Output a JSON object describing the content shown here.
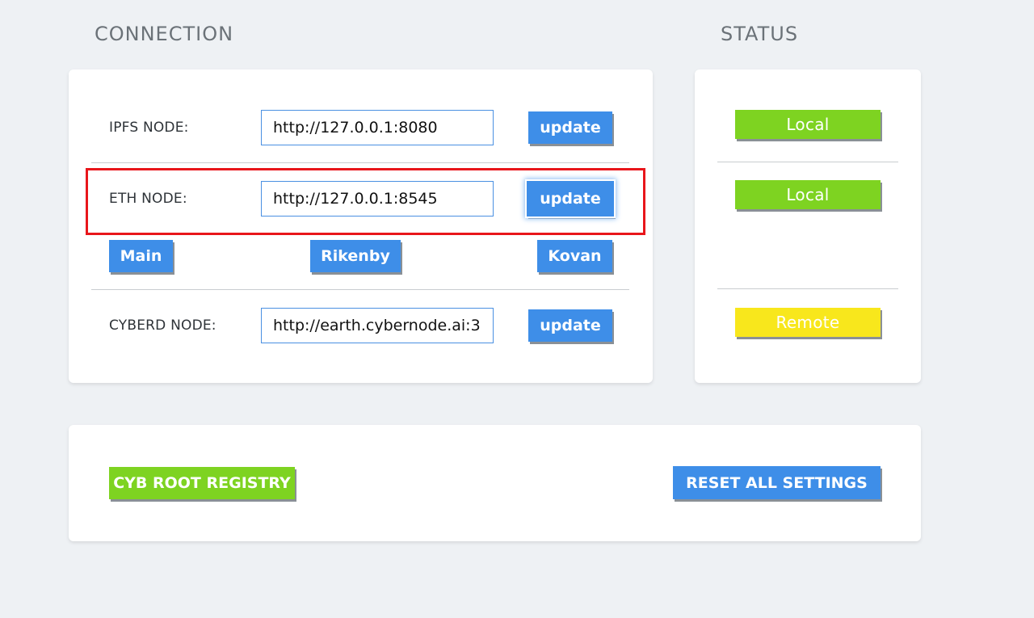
{
  "headings": {
    "connection": "CONNECTION",
    "status": "STATUS"
  },
  "connection": {
    "ipfs": {
      "label": "IPFS NODE:",
      "value": "http://127.0.0.1:8080",
      "button": "update"
    },
    "eth": {
      "label": "ETH NODE:",
      "value": "http://127.0.0.1:8545",
      "button": "update"
    },
    "networks": [
      "Main",
      "Rikenby",
      "Kovan"
    ],
    "cyberd": {
      "label": "CYBERD NODE:",
      "value": "http://earth.cybernode.ai:3",
      "button": "update"
    }
  },
  "status": {
    "ipfs": "Local",
    "eth": "Local",
    "cyberd": "Remote"
  },
  "actions": {
    "registry": "CYB ROOT REGISTRY",
    "reset": "RESET ALL SETTINGS"
  },
  "colors": {
    "blue": "#3e8ee8",
    "green": "#7ed321",
    "yellow": "#f8e71c",
    "highlight": "#e8161b"
  }
}
